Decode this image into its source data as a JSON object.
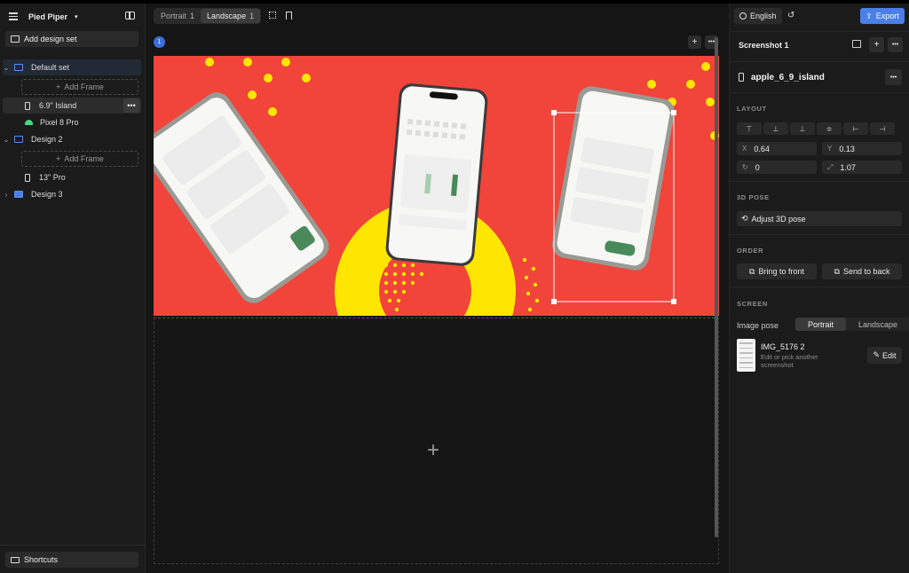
{
  "app": {
    "project_name": "Pied Piper"
  },
  "sidebar": {
    "add_design_set": "Add design set",
    "add_frame": "Add Frame",
    "shortcuts": "Shortcuts",
    "items": [
      {
        "label": "Default set",
        "type": "set"
      },
      {
        "label": "6.9\" Island",
        "type": "device"
      },
      {
        "label": "Pixel 8 Pro",
        "type": "device"
      },
      {
        "label": "Design 2",
        "type": "set"
      },
      {
        "label": "13\" Pro",
        "type": "device"
      },
      {
        "label": "Design 3",
        "type": "set"
      }
    ]
  },
  "toolbar": {
    "tabs": [
      {
        "label": "Portrait",
        "count": "1"
      },
      {
        "label": "Landscape",
        "count": "1"
      }
    ],
    "frame_badge": "1"
  },
  "canvas": {
    "add_glyph": "+",
    "background_color": "#f1443a",
    "accent_yellow": "#ffe600"
  },
  "right_panel": {
    "language": "English",
    "export_label": "Export",
    "screenshot_title": "Screenshot 1",
    "device_name": "apple_6_9_island",
    "layout_title": "LAYOUT",
    "fields": {
      "x_label": "X",
      "x_value": "0.64",
      "y_label": "Y",
      "y_value": "0.13",
      "rotation_value": "0",
      "scale_value": "1.07"
    },
    "pose_title": "3D POSE",
    "adjust_pose": "Adjust 3D pose",
    "order_title": "ORDER",
    "bring_front": "Bring to front",
    "send_back": "Send to back",
    "screen_title": "SCREEN",
    "image_pose_label": "Image pose",
    "pose_options": [
      "Portrait",
      "Landscape"
    ],
    "selected_pose": "Portrait",
    "image_name": "IMG_5176 2",
    "image_hint": "Edit or pick another screenshot",
    "edit_label": "Edit"
  },
  "colors": {
    "accent": "#4a7fe6",
    "folder": "#5b8def",
    "android": "#3ddc84"
  }
}
